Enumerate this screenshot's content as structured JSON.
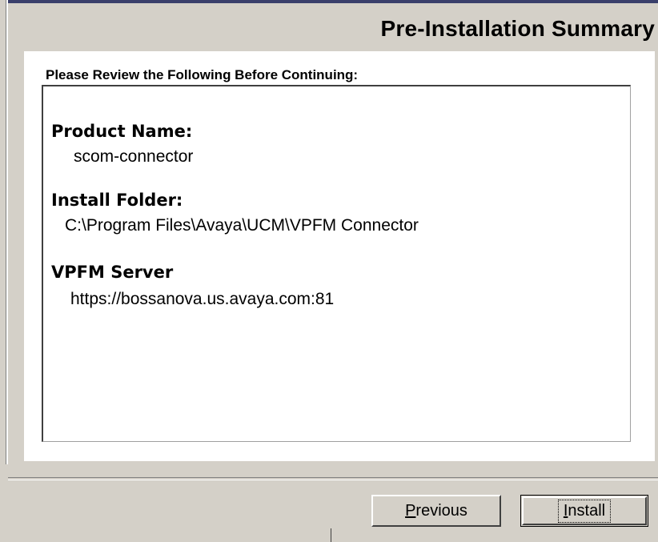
{
  "header": {
    "title": "Pre-Installation Summary"
  },
  "panel": {
    "review_label": "Please Review the Following Before Continuing:",
    "fields": [
      {
        "label": "Product Name:",
        "value": "scom-connector"
      },
      {
        "label": "Install Folder:",
        "value": "C:\\Program Files\\Avaya\\UCM\\VPFM Connector"
      },
      {
        "label": "VPFM Server",
        "value": "https://bossanova.us.avaya.com:81"
      }
    ]
  },
  "buttons": {
    "previous": {
      "mnemonic": "P",
      "rest": "revious"
    },
    "install": {
      "mnemonic": "I",
      "rest": "nstall"
    }
  },
  "colors": {
    "window_bg": "#d4d0c8",
    "panel_bg": "#ffffff",
    "top_border": "#3a3f6b"
  }
}
